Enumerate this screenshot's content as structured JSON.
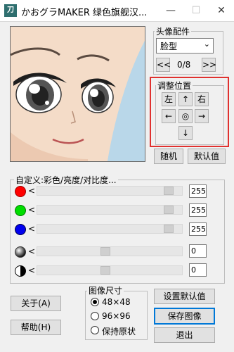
{
  "window": {
    "app_icon_text": "刀",
    "title": "かおグラMAKER 绿色旗舰汉...",
    "minimize": "—",
    "maximize": "☐",
    "close": "✕"
  },
  "parts": {
    "group_label": "头像配件",
    "selected": "脸型",
    "prev": "<<",
    "counter": "0/8",
    "next": ">>"
  },
  "position": {
    "group_label": "调整位置",
    "left": "左",
    "up": "↑",
    "right": "右",
    "arrow_left": "←",
    "center": "◎",
    "arrow_right": "→",
    "down": "↓"
  },
  "random_button": "随机",
  "default_button": "默认值",
  "color_adjust": {
    "label": "自定义:彩色/亮度/对比度...",
    "arrow": "<",
    "red": {
      "value": "255",
      "level": 1.0,
      "color": "#ff0000"
    },
    "green": {
      "value": "255",
      "level": 1.0,
      "color": "#00dd00"
    },
    "blue": {
      "value": "255",
      "level": 1.0,
      "color": "#0000ee"
    },
    "brightness": {
      "value": "0",
      "level": 0.5
    },
    "contrast": {
      "value": "0",
      "level": 0.5
    }
  },
  "image_size": {
    "group_label": "图像尺寸",
    "options": [
      "48×48",
      "96×96",
      "保持原状"
    ],
    "selected_index": 0
  },
  "buttons": {
    "about": "关于(A)",
    "help": "帮助(H)",
    "set_default": "设置默认值",
    "save_image": "保存图像",
    "exit": "退出"
  }
}
